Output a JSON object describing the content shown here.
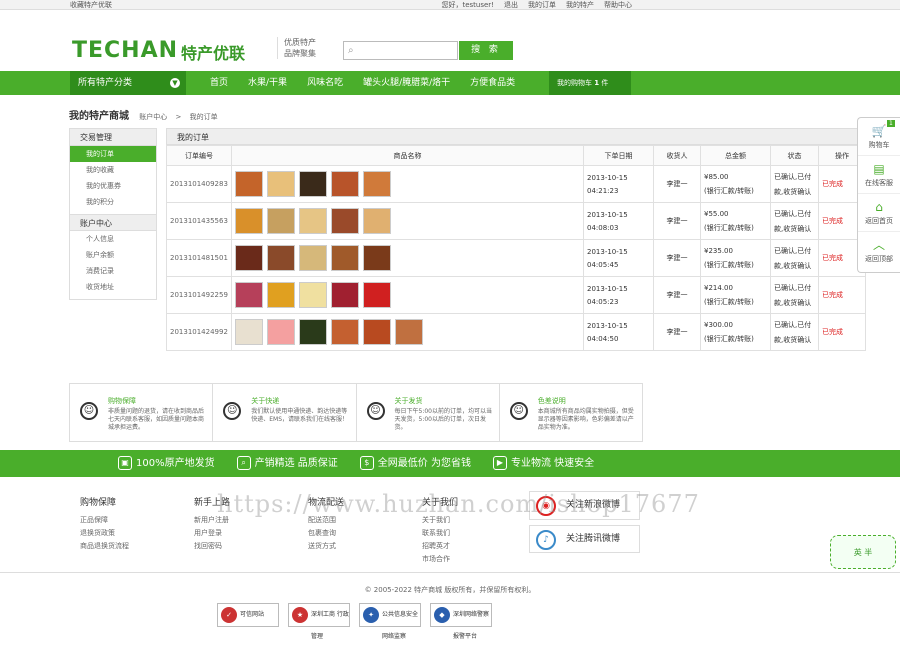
{
  "topbar": {
    "favorite": "收藏特产优联",
    "greeting": "您好，testuser!",
    "logout": "退出",
    "my_orders": "我的订单",
    "my_store": "我的特产",
    "help": "帮助中心"
  },
  "header": {
    "logo": "TECHAN",
    "logo_cn": "特产优联",
    "slogan1": "优质特产",
    "slogan2": "品牌聚集",
    "search_placeholder": "",
    "search_button": "搜 索"
  },
  "nav": {
    "category": "所有特产分类",
    "links": [
      "首页",
      "水果/干果",
      "风味名吃",
      "罐头火腿/腌腊菜/烙干",
      "方便食品类"
    ],
    "cart_label": "我的购物车",
    "cart_count": "1",
    "cart_unit": "件"
  },
  "breadcrumb": {
    "title": "我的特产商城",
    "path1": "账户中心",
    "sep": ">",
    "path2": "我的订单"
  },
  "sidebar": {
    "sections": [
      {
        "title": "交易管理",
        "items": [
          "我的订单",
          "我的收藏",
          "我的优惠券",
          "我的积分"
        ]
      },
      {
        "title": "账户中心",
        "items": [
          "个人信息",
          "账户余额",
          "消费记录",
          "收货地址"
        ]
      }
    ]
  },
  "orders": {
    "title": "我的订单",
    "headers": [
      "订单编号",
      "商品名称",
      "下单日期",
      "收货人",
      "总金额",
      "状态",
      "操作"
    ],
    "rows": [
      {
        "id": "2013101409283",
        "date": "2013-10-15",
        "time": "04:21:23",
        "receiver": "李建一",
        "amount": "¥85.00",
        "pay": "(银行汇款/转账)",
        "status1": "已确认,已付",
        "status2": "款,收货确认",
        "action": "已完成"
      },
      {
        "id": "2013101435563",
        "date": "2013-10-15",
        "time": "04:08:03",
        "receiver": "李建一",
        "amount": "¥55.00",
        "pay": "(银行汇款/转账)",
        "status1": "已确认,已付",
        "status2": "款,收货确认",
        "action": "已完成"
      },
      {
        "id": "2013101481501",
        "date": "2013-10-15",
        "time": "04:05:45",
        "receiver": "李建一",
        "amount": "¥235.00",
        "pay": "(银行汇款/转账)",
        "status1": "已确认,已付",
        "status2": "款,收货确认",
        "action": "已完成"
      },
      {
        "id": "2013101492259",
        "date": "2013-10-15",
        "time": "04:05:23",
        "receiver": "李建一",
        "amount": "¥214.00",
        "pay": "(银行汇款/转账)",
        "status1": "已确认,已付",
        "status2": "款,收货确认",
        "action": "已完成"
      },
      {
        "id": "2013101424992",
        "date": "2013-10-15",
        "time": "04:04:50",
        "receiver": "李建一",
        "amount": "¥300.00",
        "pay": "(银行汇款/转账)",
        "status1": "已确认,已付",
        "status2": "款,收货确认",
        "action": "已完成"
      }
    ]
  },
  "right_bar": {
    "cart": "购物车",
    "cart_badge": "1",
    "service": "在线客服",
    "home": "返回首页",
    "top": "返回顶部"
  },
  "service": [
    {
      "title": "购物保障",
      "text": "非质量问题的退货，请在收到商品后七天内联系客服，如因质量问题本商城承担运费。"
    },
    {
      "title": "关于快递",
      "text": "我们默认使用申通快递、韵达快递等快递、EMS，请联系我们在线客服！"
    },
    {
      "title": "关于发货",
      "text": "每日下午5:00以前的订单，均可以当天发货，5:00以后的订单，次日发货。"
    },
    {
      "title": "色差说明",
      "text": "本商城所有商品均属实物拍摄，但受显示器等因素影响，色彩偏差请以产品实物为准。"
    }
  ],
  "green_bar": [
    "100%原产地发货",
    "产销精选 品质保证",
    "全网最低价 为您省钱",
    "专业物流 快速安全"
  ],
  "footer": {
    "cols": [
      {
        "title": "购物保障",
        "links": [
          "正品保障",
          "退换货政策",
          "商品退换货流程"
        ]
      },
      {
        "title": "新手上路",
        "links": [
          "新用户注册",
          "用户登录",
          "找回密码"
        ]
      },
      {
        "title": "物流配送",
        "links": [
          "配送范围",
          "包裹查询",
          "送货方式"
        ]
      },
      {
        "title": "关于我们",
        "links": [
          "关于我们",
          "联系我们",
          "招聘英才",
          "市场合作"
        ]
      }
    ],
    "weibo": "关注新浪微博",
    "tweibo": "关注腾讯微博",
    "watermark": "https://www.huzhan.com/ishop17677",
    "stamp": "英 半",
    "copyright": "© 2005-2022 特产商城 版权所有，并保留所有权利。",
    "badges": [
      "可信网站",
      "深圳工商 行政管理",
      "公共信息安全 网络监察",
      "深圳网络警察 报警平台"
    ]
  },
  "colors": {
    "brand": "#4aae2b",
    "brand_dark": "#2f8d1b",
    "done": "#dd2222"
  }
}
